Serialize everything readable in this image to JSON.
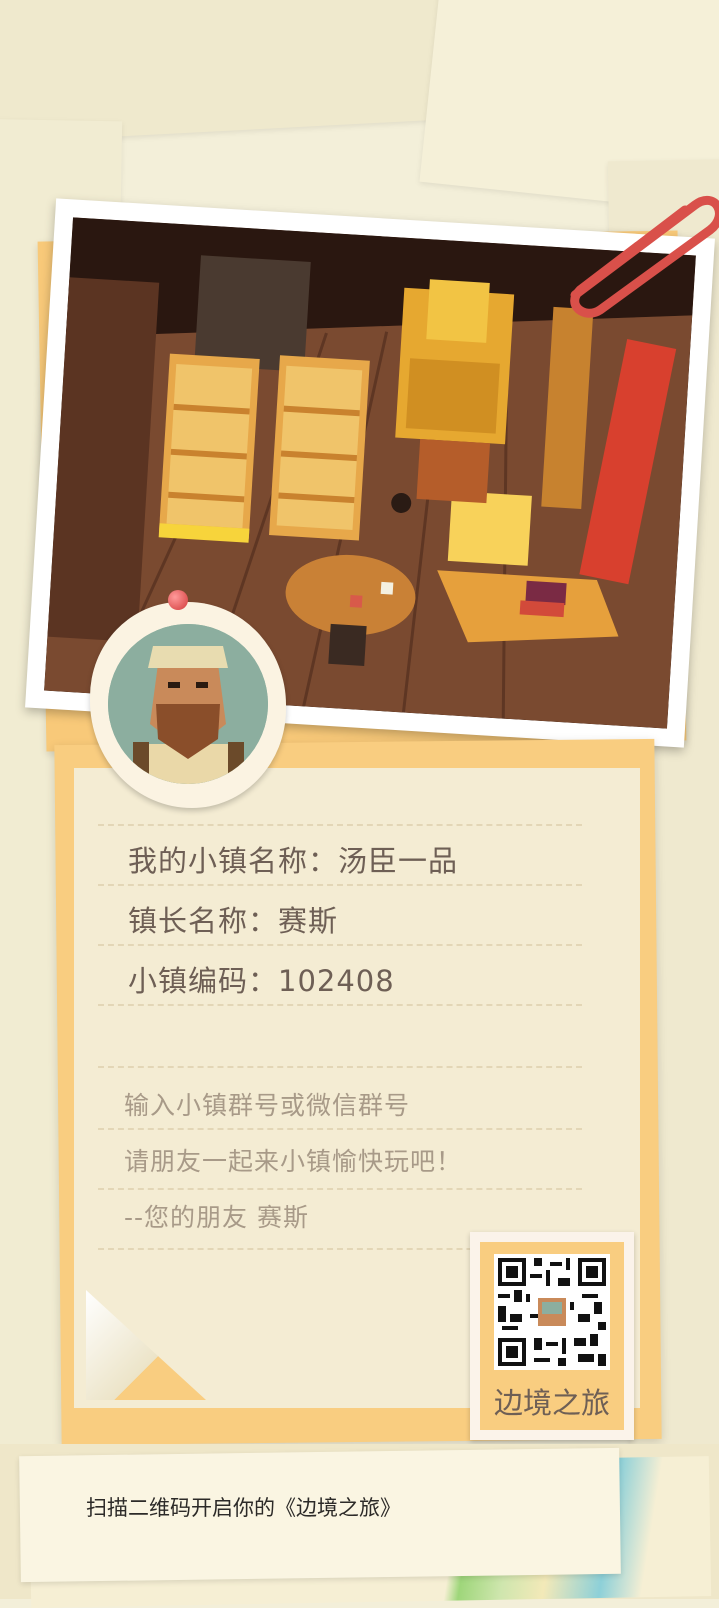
{
  "town": {
    "name_label": "我的小镇名称：汤臣一品",
    "mayor_label": "镇长名称：赛斯",
    "code_label": "小镇编码：102408"
  },
  "message": {
    "line1": "输入小镇群号或微信群号",
    "line2": "请朋友一起来小镇愉快玩吧！",
    "line3": "--您的朋友  赛斯"
  },
  "stamp": {
    "label": "边境之旅"
  },
  "footer": {
    "scan_text": "扫描二维码开启你的《边境之旅》"
  },
  "colors": {
    "note_orange": "#f9cd80",
    "paper": "#f4ecd3",
    "text_main": "#6e5f55",
    "text_muted": "#a89a88",
    "clip_red": "#d9504a"
  },
  "icons": {
    "clip": "paperclip-icon",
    "pin": "pushpin-icon",
    "qr": "qr-code-icon"
  }
}
